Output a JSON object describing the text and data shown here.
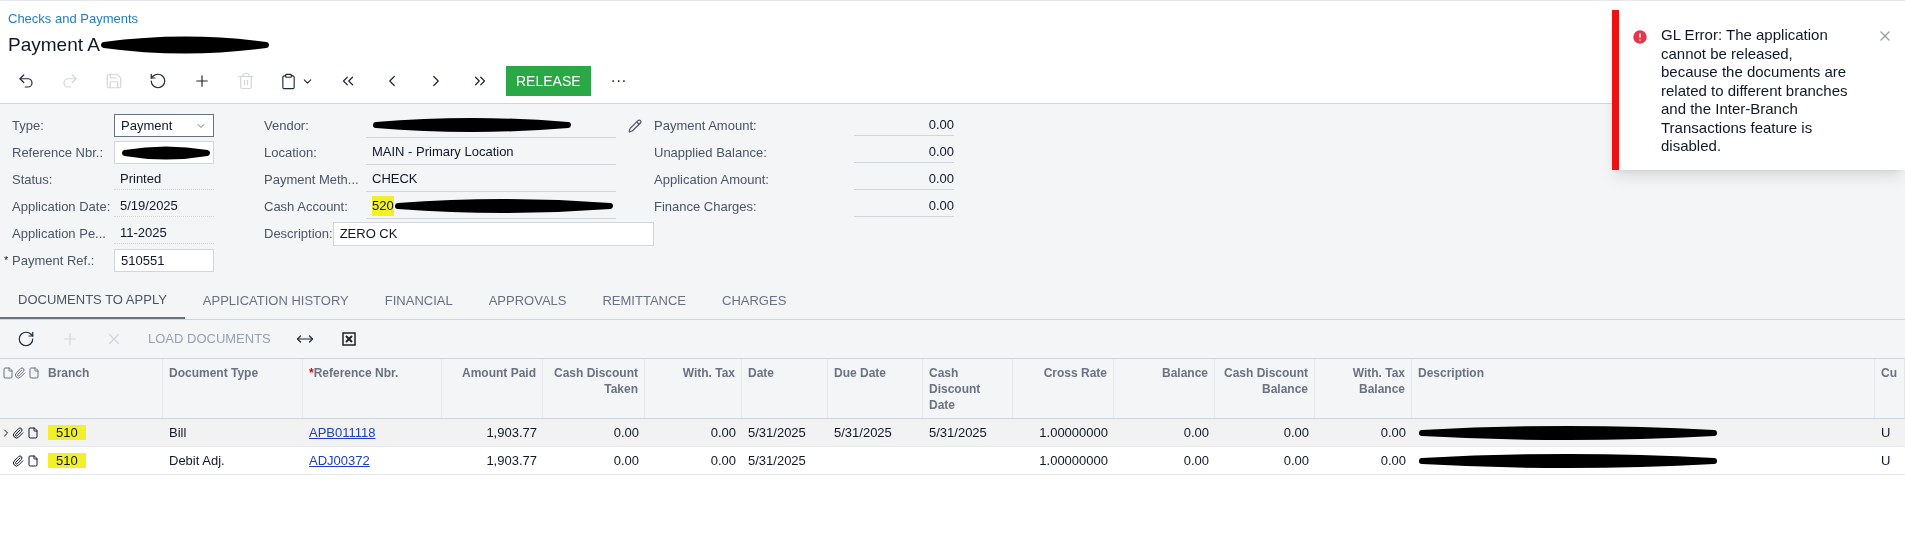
{
  "breadcrumb": "Checks and Payments",
  "title": "Payment A",
  "toolbar": {
    "release": "RELEASE",
    "more": "···"
  },
  "form": {
    "left": [
      {
        "label": "Type:",
        "value": "Payment",
        "kind": "select"
      },
      {
        "label": "Reference Nbr.:",
        "kind": "field"
      },
      {
        "label": "Status:",
        "value": "Printed",
        "kind": "text"
      },
      {
        "label": "Application Date:",
        "value": "5/19/2025",
        "kind": "text"
      },
      {
        "label": "Application Pe...",
        "value": "11-2025",
        "kind": "text"
      },
      {
        "label": "Payment Ref.:",
        "value": "510551",
        "kind": "field",
        "mark": "*"
      }
    ],
    "middle": [
      {
        "label": "Vendor:"
      },
      {
        "label": "Location:",
        "value": "MAIN - Primary Location"
      },
      {
        "label": "Payment Meth...",
        "value": "CHECK"
      },
      {
        "label": "Cash Account:",
        "value": "520"
      },
      {
        "label": "Description:",
        "value": "ZERO CK"
      }
    ],
    "right": [
      {
        "label": "Payment Amount:",
        "value": "0.00"
      },
      {
        "label": "Unapplied Balance:",
        "value": "0.00"
      },
      {
        "label": "Application Amount:",
        "value": "0.00"
      },
      {
        "label": "Finance Charges:",
        "value": "0.00"
      }
    ]
  },
  "tabs": [
    {
      "label": "DOCUMENTS TO APPLY",
      "selected": true
    },
    {
      "label": "APPLICATION HISTORY",
      "selected": false
    },
    {
      "label": "FINANCIAL",
      "selected": false
    },
    {
      "label": "APPROVALS",
      "selected": false
    },
    {
      "label": "REMITTANCE",
      "selected": false
    },
    {
      "label": "CHARGES",
      "selected": false
    }
  ],
  "grid_toolbar": {
    "load": "LOAD DOCUMENTS"
  },
  "table": {
    "columns": [
      {
        "label": "Branch"
      },
      {
        "label": "Document Type"
      },
      {
        "label": "Reference Nbr.",
        "mark": "*"
      },
      {
        "label": "Amount Paid"
      },
      {
        "label": "Cash Discount Taken"
      },
      {
        "label": "With. Tax"
      },
      {
        "label": "Date"
      },
      {
        "label": "Due Date"
      },
      {
        "label": "Cash Discount Date"
      },
      {
        "label": "Cross Rate"
      },
      {
        "label": "Balance"
      },
      {
        "label": "Cash Discount Balance"
      },
      {
        "label": "With. Tax Balance"
      },
      {
        "label": "Description"
      },
      {
        "label": "Cu"
      }
    ],
    "rows": [
      {
        "selected": true,
        "cells": [
          "510",
          "Bill",
          "APB011118",
          "1,903.77",
          "0.00",
          "0.00",
          "5/31/2025",
          "5/31/2025",
          "5/31/2025",
          "1.00000000",
          "0.00",
          "0.00",
          "0.00",
          null,
          "U"
        ]
      },
      {
        "selected": false,
        "cells": [
          "510",
          "Debit Adj.",
          "ADJ00372",
          "1,903.77",
          "0.00",
          "0.00",
          "5/31/2025",
          null,
          null,
          "1.00000000",
          "0.00",
          "0.00",
          "0.00",
          null,
          "U"
        ]
      }
    ]
  },
  "toast": {
    "message": "GL Error: The application cannot be released, because the documents are related to different branches and the Inter-Branch Transactions feature is disabled."
  }
}
